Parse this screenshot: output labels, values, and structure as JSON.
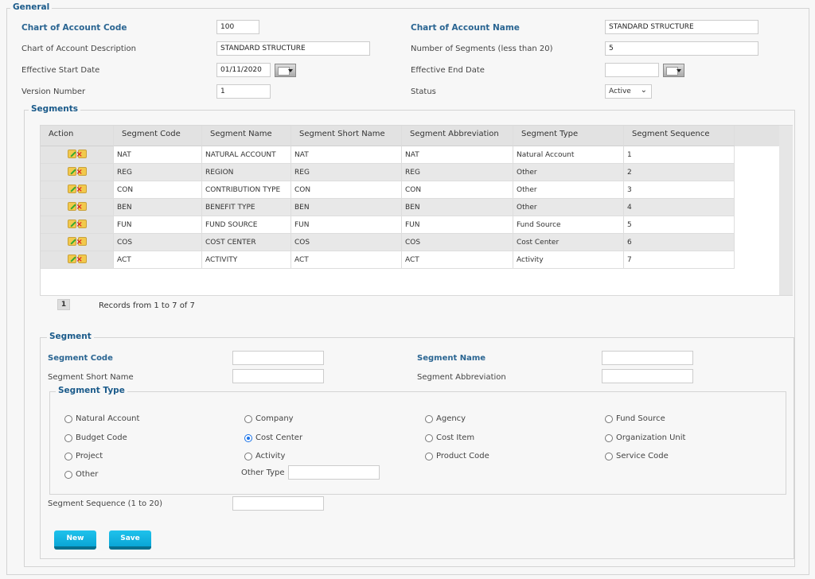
{
  "general": {
    "legend": "General",
    "coa_code_label": "Chart of Account Code",
    "coa_code": "100",
    "coa_name_label": "Chart of Account Name",
    "coa_name": "STANDARD STRUCTURE",
    "coa_desc_label": "Chart of Account Description",
    "coa_desc": "STANDARD STRUCTURE",
    "num_segments_label": "Number of Segments (less than 20)",
    "num_segments": "5",
    "start_date_label": "Effective Start Date",
    "start_date": "01/11/2020",
    "end_date_label": "Effective End Date",
    "end_date": "",
    "version_label": "Version Number",
    "version": "1",
    "status_label": "Status",
    "status": "Active"
  },
  "segments": {
    "legend": "Segments",
    "columns": [
      "Action",
      "Segment Code",
      "Segment Name",
      "Segment Short Name",
      "Segment Abbreviation",
      "Segment Type",
      "Segment Sequence"
    ],
    "rows": [
      [
        "NAT",
        "NATURAL ACCOUNT",
        "NAT",
        "NAT",
        "Natural Account",
        "1"
      ],
      [
        "REG",
        "REGION",
        "REG",
        "REG",
        "Other",
        "2"
      ],
      [
        "CON",
        "CONTRIBUTION TYPE",
        "CON",
        "CON",
        "Other",
        "3"
      ],
      [
        "BEN",
        "BENEFIT TYPE",
        "BEN",
        "BEN",
        "Other",
        "4"
      ],
      [
        "FUN",
        "FUND SOURCE",
        "FUN",
        "FUN",
        "Fund Source",
        "5"
      ],
      [
        "COS",
        "COST CENTER",
        "COS",
        "COS",
        "Cost Center",
        "6"
      ],
      [
        "ACT",
        "ACTIVITY",
        "ACT",
        "ACT",
        "Activity",
        "7"
      ]
    ],
    "page": "1",
    "records": "Records from 1 to 7 of 7"
  },
  "segment": {
    "legend": "Segment",
    "code_label": "Segment Code",
    "code": "",
    "name_label": "Segment Name",
    "name": "",
    "short_label": "Segment Short Name",
    "short": "",
    "abbr_label": "Segment Abbreviation",
    "abbr": "",
    "type_legend": "Segment Type",
    "types": [
      "Natural Account",
      "Company",
      "Agency",
      "Fund Source",
      "Budget Code",
      "Cost Center",
      "Cost Item",
      "Organization Unit",
      "Project",
      "Activity",
      "Product Code",
      "Service Code",
      "Other"
    ],
    "selected_type": "Cost Center",
    "other_type_label": "Other Type",
    "other_type": "",
    "sequence_label": "Segment Sequence (1 to 20)",
    "sequence": "",
    "new_label": "New",
    "save_label": "Save"
  }
}
